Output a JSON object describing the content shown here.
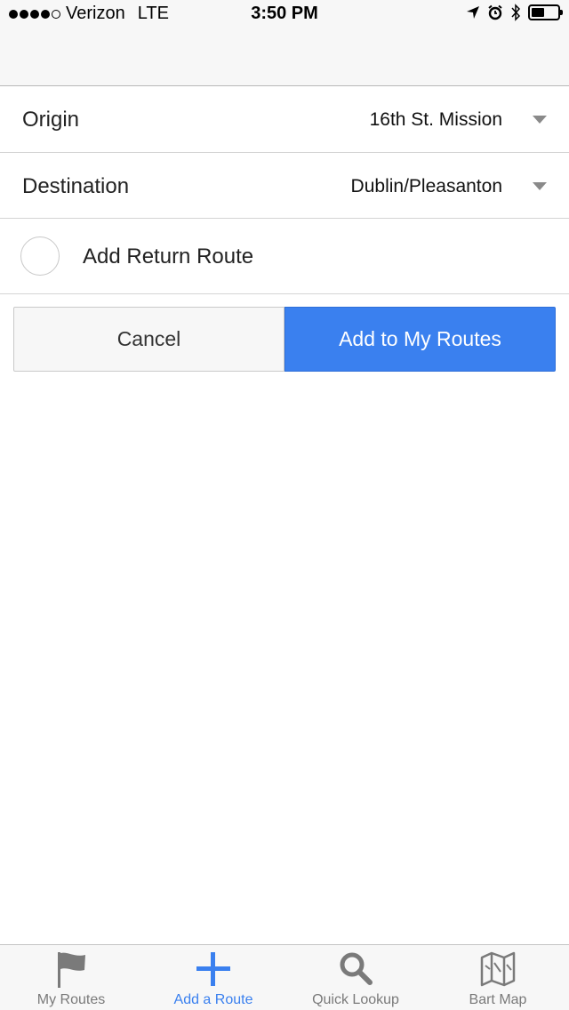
{
  "status_bar": {
    "carrier": "Verizon",
    "network": "LTE",
    "time": "3:50 PM"
  },
  "form": {
    "origin": {
      "label": "Origin",
      "value": "16th St. Mission"
    },
    "destination": {
      "label": "Destination",
      "value": "Dublin/Pleasanton"
    },
    "return_route": {
      "label": "Add Return Route",
      "checked": false
    }
  },
  "buttons": {
    "cancel": "Cancel",
    "add": "Add to My Routes"
  },
  "tabs": [
    {
      "label": "My Routes",
      "icon": "flag-icon",
      "active": false
    },
    {
      "label": "Add a Route",
      "icon": "plus-icon",
      "active": true
    },
    {
      "label": "Quick Lookup",
      "icon": "magnifier-icon",
      "active": false
    },
    {
      "label": "Bart Map",
      "icon": "map-icon",
      "active": false
    }
  ],
  "colors": {
    "accent": "#3a80ef",
    "inactive_tab": "#7a7a7a"
  }
}
